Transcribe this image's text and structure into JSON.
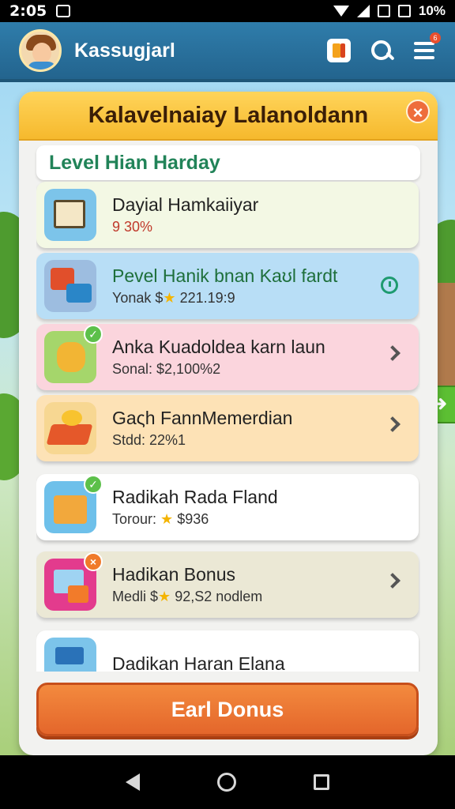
{
  "status_bar": {
    "time": "2:05",
    "battery": "10%"
  },
  "app_bar": {
    "title": "Kassugjarl",
    "menu_badge_count": "6"
  },
  "panel": {
    "title": "Kalavelnaiay Lalanoldann",
    "close_label": "×",
    "section_title": "Level Hian Harday"
  },
  "items": [
    {
      "name": "Dayial Hamkaiiyar",
      "sub": "9 30%",
      "bg": "#f3f8e4",
      "icon": "document-icon",
      "accent": "#4da6d9"
    },
    {
      "name": "Pevel Hanik bnan Kaʊl fardt",
      "sub_prefix": "Yonak $",
      "sub_value": "221.19:9",
      "bg": "#b8def6",
      "icon": "gift-box-icon",
      "accent": "#e14f2b"
    },
    {
      "name": "Anka Kuadoldea karn laun",
      "sub": "Sonal: $2,100%2",
      "bg": "#fbd5dd",
      "icon": "lion-toy-icon",
      "accent": "#8bc34a"
    },
    {
      "name": "Gaςh FannMemerdian",
      "sub": "Stdd: 22%1",
      "bg": "#fde2b6",
      "icon": "gold-bar-icon",
      "accent": "#f29a1d"
    },
    {
      "name": "Radikah Rada Fland",
      "sub_prefix": "Torour: ",
      "sub_value": "$936",
      "bg": "#ffffff",
      "icon": "package-icon",
      "accent": "#4db0e0"
    },
    {
      "name": "Hadikan Bonus",
      "sub_prefix": "Medli $",
      "sub_value": "92,S2 nodlem",
      "bg": "#ebe8d5",
      "icon": "bonus-gift-icon",
      "accent": "#e33b8d"
    },
    {
      "name": "Dadikan Haran Elana",
      "sub": "",
      "bg": "#ffffff",
      "icon": "card-icon",
      "accent": "#4da6d9"
    }
  ],
  "earn_button": {
    "label": "Earl Donus"
  },
  "side_arrow": "➜",
  "colors": {
    "app_bar": "#2a71a0",
    "header_gold": "#f6b92d",
    "section_green": "#218358",
    "earn_orange": "#e4662b"
  }
}
